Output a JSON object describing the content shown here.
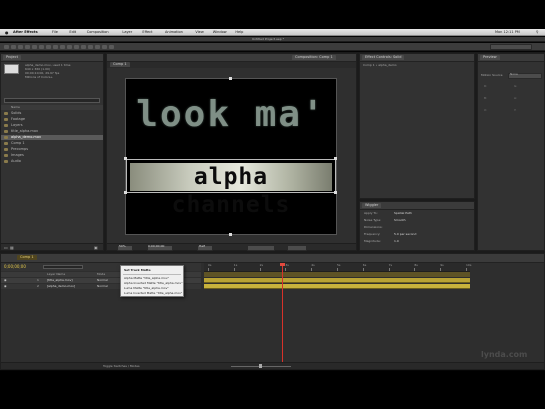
{
  "menubar": {
    "app_name": "After Effects",
    "items": [
      "File",
      "Edit",
      "Composition",
      "Layer",
      "Effect",
      "Animation",
      "View",
      "Window",
      "Help"
    ],
    "clock": "Mon 12:11 PM"
  },
  "window": {
    "title": "Untitled Project.aep *"
  },
  "project": {
    "tab": "Project",
    "thumb_info": "alpha_demo.mov, used 1 time",
    "thumb_info2": "640 x 360 (1.00)",
    "thumb_info3": "00;00;10;00, 29.97 fps",
    "thumb_info4": "Millions of Colors+",
    "search_placeholder": "",
    "col_name": "Name",
    "items": [
      {
        "label": "Solids",
        "selected": false
      },
      {
        "label": "Footage",
        "selected": false
      },
      {
        "label": "Layers",
        "selected": false
      },
      {
        "label": "title_alpha.mov",
        "selected": false
      },
      {
        "label": "alpha_demo.mov",
        "selected": true
      },
      {
        "label": "Comp 1",
        "selected": false
      },
      {
        "label": "Precomps",
        "selected": false
      },
      {
        "label": "Images",
        "selected": false
      },
      {
        "label": "Audio",
        "selected": false
      }
    ]
  },
  "composition": {
    "tab": "Composition: Comp 1",
    "subtab": "Comp 1",
    "title_line1": "look ma'",
    "title_line2": "alpha channels",
    "zoom": "50%",
    "timecode": "0;00;00;00",
    "resolution": "Half"
  },
  "effect_controls": {
    "tab": "Effect Controls: Solid",
    "layer": "Comp 1 • alpha_demo"
  },
  "info_panel": {
    "tab": "Info",
    "rows": [
      "R:",
      "G:",
      "B:",
      "A:",
      "X:",
      "Y:"
    ]
  },
  "right_panel": {
    "tab": "Preview",
    "label1": "Motion Source",
    "value1": "None"
  },
  "align_panel": {
    "tab": "Wiggler",
    "rows": [
      {
        "label": "Apply To:",
        "value": "Spatial Path"
      },
      {
        "label": "Noise Type:",
        "value": "Smooth"
      },
      {
        "label": "Dimensions:",
        "value": ""
      },
      {
        "label": "Frequency:",
        "value": "5.0 per second"
      },
      {
        "label": "Magnitude:",
        "value": "1.0"
      }
    ]
  },
  "timeline": {
    "tab": "Comp 1",
    "timecode": "0;00;00;00",
    "col_layer": "Layer Name",
    "col_mode": "Mode",
    "layers": [
      {
        "num": "1",
        "name": "[title_alpha.mov]",
        "mode": "Normal"
      },
      {
        "num": "2",
        "name": "[alpha_demo.mov]",
        "mode": "Normal"
      }
    ],
    "ruler": [
      "0s",
      "1s",
      "2s",
      "3s",
      "4s",
      "5s",
      "6s",
      "7s",
      "8s",
      "9s",
      "10s"
    ]
  },
  "context_menu": {
    "items": [
      "Set Track Matte",
      "",
      "Alpha Matte \"title_alpha.mov\"",
      "Alpha Inverted Matte \"title_alpha.mov\"",
      "Luma Matte \"title_alpha.mov\"",
      "Luma Inverted Matte \"title_alpha.mov\""
    ]
  },
  "bottom_bar": {
    "label": "Toggle Switches / Modes"
  },
  "watermark": {
    "text": "lynda.com"
  },
  "colors": {
    "accent_yellow": "#c8b23c",
    "playhead": "#d8322a",
    "panel_bg": "#323232",
    "workbar": "#6b5b2a"
  }
}
